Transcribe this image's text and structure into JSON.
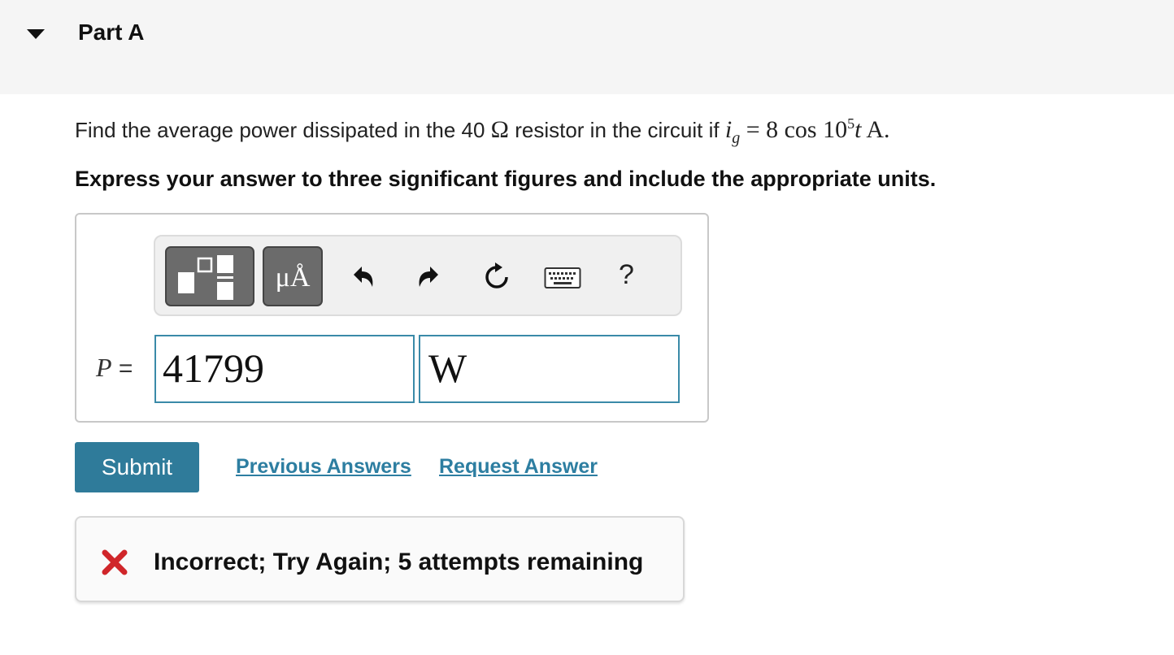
{
  "part": {
    "title": "Part A"
  },
  "question": {
    "prefix": "Find the average power dissipated in the 40",
    "ohm_symbol": "Ω",
    "middle": "resistor in the circuit if",
    "var_base": "i",
    "var_sub": "g",
    "equals": "=",
    "expr_lead": "8 cos 10",
    "expr_exp": "5",
    "expr_t": "t",
    "expr_unit": "A."
  },
  "instruction": "Express your answer to three significant figures and include the appropriate units.",
  "toolbar": {
    "units_label": "μÅ",
    "help_label": "?",
    "icons": [
      "templates-icon",
      "units-icon",
      "undo-icon",
      "redo-icon",
      "reset-icon",
      "keyboard-icon",
      "help-icon"
    ]
  },
  "answer": {
    "variable": "P",
    "equals": "=",
    "value": "41799",
    "units": "W"
  },
  "actions": {
    "submit_label": "Submit",
    "previous_answers_label": "Previous Answers",
    "request_answer_label": "Request Answer"
  },
  "feedback": {
    "message": "Incorrect; Try Again; 5 attempts remaining"
  },
  "colors": {
    "accent": "#2f7b9a",
    "link": "#2d7ea1",
    "error": "#d0262a",
    "input_border": "#3a8aa8"
  }
}
